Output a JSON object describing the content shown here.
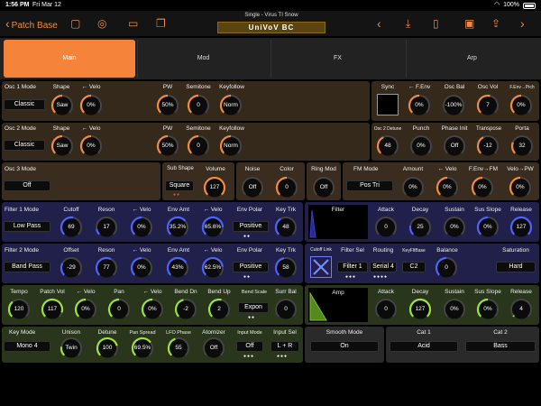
{
  "statusbar": {
    "time": "1:56 PM",
    "date": "Fri Mar 12",
    "battery": "100%"
  },
  "toolbar": {
    "back_label": "Patch Base",
    "preset_title": "Single - Virus TI Snow",
    "patch_name": "UniVoV  BC"
  },
  "colors": {
    "accent": "#f08a3c",
    "tab_active": "#f5833a"
  },
  "tabs": [
    "Main",
    "Mod",
    "FX",
    "Arp"
  ],
  "main": {
    "osc1": {
      "mode_label": "Osc 1 Mode",
      "mode": "Classic",
      "shape_label": "Shape",
      "shape": "Saw",
      "velo_label": "← Velo",
      "velo": "0%",
      "pw_label": "PW",
      "pw": "50%",
      "semitone_label": "Semitone",
      "semitone": "0",
      "keyfollow_label": "Keyfollow",
      "keyfollow": "Norm"
    },
    "osc2": {
      "mode_label": "Osc 2 Mode",
      "mode": "Classic",
      "shape_label": "Shape",
      "shape": "Saw",
      "velo_label": "← Velo",
      "velo": "0%",
      "pw_label": "PW",
      "pw": "50%",
      "semitone_label": "Semitone",
      "semitone": "0",
      "keyfollow_label": "Keyfollow",
      "keyfollow": "Norm"
    },
    "osc_right1": {
      "sync_label": "Sync",
      "fenv_label": "← F.Env",
      "fenv": "0%",
      "oscbal_label": "Osc Bal",
      "oscbal": "-100%",
      "oscvol_label": "Osc Vol",
      "oscvol": "7",
      "fenvpitch_label": "F.Env→Pich",
      "fenvpitch": "0%"
    },
    "osc_right2": {
      "detune_label": "Osc 2 Detune",
      "detune": "48",
      "punch_label": "Punch",
      "punch": "0%",
      "phase_label": "Phase Init",
      "phase": "Off",
      "transpose_label": "Transpose",
      "transpose": "-12",
      "porta_label": "Porta",
      "porta": "32"
    },
    "osc3": {
      "mode_label": "Osc 3 Mode",
      "mode": "Off",
      "subshape_label": "Sub Shape",
      "subshape": "Square",
      "volume_label": "Volume",
      "volume": "127",
      "noise_label": "Noise",
      "noise": "Off",
      "color_label": "Color",
      "color": "0",
      "ringmod_label": "Ring Mod",
      "ringmod": "Off",
      "fmmode_label": "FM Mode",
      "fmmode": "Pos Tri",
      "amount_label": "Amount",
      "amount": "0%",
      "velo_label": "← Velo",
      "velo": "0%",
      "fenvfm_label": "F.Env→FM",
      "fenvfm": "0%",
      "velopw_label": "Velo→PW",
      "velopw": "0%"
    },
    "filter1": {
      "mode_label": "Filter 1 Mode",
      "mode": "Low Pass",
      "cutoff_label": "Cutoff",
      "cutoff": "69",
      "reson_label": "Reson",
      "reson": "17",
      "velo_label": "← Velo",
      "velo": "0%",
      "envamt_label": "Env Amt",
      "envamt": "35.2%",
      "velo2_label": "← Velo",
      "velo2": "65.6%",
      "envpolar_label": "Env Polar",
      "envpolar": "Positive",
      "keytrk_label": "Key Trk",
      "keytrk": "48"
    },
    "filter2": {
      "mode_label": "Filter 2 Mode",
      "mode": "Band Pass",
      "offset_label": "Offset",
      "offset": "-29",
      "reson_label": "Reson",
      "reson": "77",
      "velo_label": "← Velo",
      "velo": "0%",
      "envamt_label": "Env Amt",
      "envamt": "43%",
      "velo2_label": "← Velo",
      "velo2": "62.5%",
      "envpolar_label": "Env Polar",
      "envpolar": "Positive",
      "keytrk_label": "Key Trk",
      "keytrk": "58"
    },
    "filter_env": {
      "title": "Filter",
      "attack_label": "Attack",
      "attack": "0",
      "decay_label": "Decay",
      "decay": "25",
      "sustain_label": "Sustain",
      "sustain": "0%",
      "susslope_label": "Sus Slope",
      "susslope": "0%",
      "release_label": "Release",
      "release": "127"
    },
    "filter_routing": {
      "cutofflink_label": "Cutoff Link",
      "filtersel_label": "Filter Sel",
      "filtersel": "Filter 1",
      "routing_label": "Routing",
      "routing": "Serial 4",
      "keyflt_label": "KeyFltBase",
      "keyflt": "C2",
      "balance_label": "Balance",
      "balance": "0",
      "saturation_label": "Saturation",
      "saturation": "Hard"
    },
    "amp_row1": {
      "tempo_label": "Tempo",
      "tempo": "120",
      "patchvol_label": "Patch Vol",
      "patchvol": "117",
      "velo_label": "← Velo",
      "velo": "0%",
      "pan_label": "Pan",
      "pan": "0",
      "velo2_label": "← Velo",
      "velo2": "0%",
      "benddn_label": "Bend Dn",
      "benddn": "-2",
      "bendup_label": "Bend Up",
      "bendup": "2",
      "bendscale_label": "Bend Scale",
      "bendscale": "Expon",
      "surrbal_label": "Surr Bal",
      "surrbal": "0"
    },
    "amp_row2": {
      "keymode_label": "Key Mode",
      "keymode": "Mono 4",
      "unison_label": "Unison",
      "unison": "Twin",
      "detune_label": "Detune",
      "detune": "100",
      "panspread_label": "Pan Spread",
      "panspread": "69.5%",
      "lfophase_label": "LFO Phase",
      "lfophase": "55",
      "atomizer_label": "Atomizer",
      "atomizer": "Off",
      "inputmode_label": "Input Mode",
      "inputmode": "Off",
      "inputsel_label": "Input Sel",
      "inputsel": "L + R"
    },
    "amp_env": {
      "title": "Amp",
      "attack_label": "Attack",
      "attack": "0",
      "decay_label": "Decay",
      "decay": "127",
      "sustain_label": "Sustain",
      "sustain": "0%",
      "susslope_label": "Sus Slope",
      "susslope": "0%",
      "release_label": "Release",
      "release": "4"
    },
    "bottom": {
      "smooth_label": "Smooth Mode",
      "smooth": "On",
      "cat1_label": "Cat 1",
      "cat1": "Acid",
      "cat2_label": "Cat 2",
      "cat2": "Bass"
    }
  }
}
